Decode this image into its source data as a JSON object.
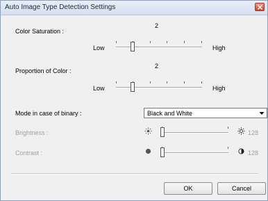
{
  "window": {
    "title": "Auto Image Type Detection Settings"
  },
  "color_saturation": {
    "label": "Color Saturation :",
    "value": "2",
    "low_label": "Low",
    "high_label": "High",
    "level_fraction": 0.2
  },
  "proportion_of_color": {
    "label": "Proportion of Color :",
    "value": "2",
    "low_label": "Low",
    "high_label": "High",
    "level_fraction": 0.2
  },
  "binary_mode": {
    "label": "Mode in case of binary :",
    "selected": "Black and White"
  },
  "brightness": {
    "label": "Brightness :",
    "value": "128",
    "disabled": true
  },
  "contrast": {
    "label": "Contrast :",
    "value": "128",
    "disabled": true
  },
  "buttons": {
    "ok": "OK",
    "cancel": "Cancel"
  },
  "icons": {
    "close": "close-icon",
    "brightness_low": "sun-dim-icon",
    "brightness_high": "sun-bright-icon",
    "contrast_low": "circle-full-icon",
    "contrast_high": "circle-half-icon",
    "dropdown": "chevron-down-icon"
  },
  "colors": {
    "close_button": "#c9442a",
    "disabled_text": "#a0a0a0"
  }
}
